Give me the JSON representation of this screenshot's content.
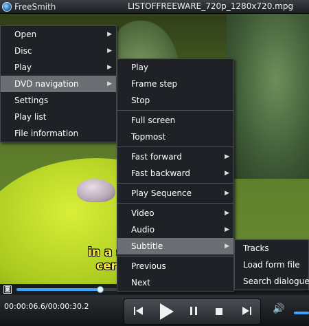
{
  "window": {
    "app_name": "FreeSmith",
    "file_title": "LISTOFFREEWARE_720p_1280x720.mpg"
  },
  "video": {
    "subtitle_line1": "in a s",
    "subtitle_line2": "cert"
  },
  "seek": {
    "progress": 0.29
  },
  "controls": {
    "time": "00:00:06.6/00:00:30.2",
    "buttons": [
      "previous",
      "play",
      "pause",
      "stop",
      "next"
    ],
    "volume_level": 1.0
  },
  "menus": {
    "main": [
      {
        "label": "Open",
        "submenu": true
      },
      {
        "label": "Disc",
        "submenu": true
      },
      {
        "label": "Play",
        "submenu": true
      },
      {
        "label": "DVD navigation",
        "submenu": true,
        "highlighted": true
      },
      {
        "label": "Settings",
        "submenu": false
      },
      {
        "label": "Play list",
        "submenu": false
      },
      {
        "label": "File information",
        "submenu": false
      }
    ],
    "play": [
      {
        "label": "Play"
      },
      {
        "label": "Frame step"
      },
      {
        "label": "Stop"
      },
      {
        "label": "Full screen"
      },
      {
        "label": "Topmost"
      },
      {
        "label": "Fast forward"
      },
      {
        "label": "Fast backward"
      },
      {
        "label": "Play Sequence"
      },
      {
        "label": "Video"
      },
      {
        "label": "Audio"
      },
      {
        "label": "Subtitle",
        "highlighted": true
      },
      {
        "label": "Previous"
      },
      {
        "label": "Next"
      }
    ],
    "subtitle": [
      {
        "label": "Tracks"
      },
      {
        "label": "Load form file"
      },
      {
        "label": "Search dialogue"
      }
    ]
  },
  "colors": {
    "accent": "#3ea3ff",
    "subtitle_text": "#f7e83a",
    "menu_bg": "#1e2226",
    "menu_highlight": "#6b6e72"
  }
}
